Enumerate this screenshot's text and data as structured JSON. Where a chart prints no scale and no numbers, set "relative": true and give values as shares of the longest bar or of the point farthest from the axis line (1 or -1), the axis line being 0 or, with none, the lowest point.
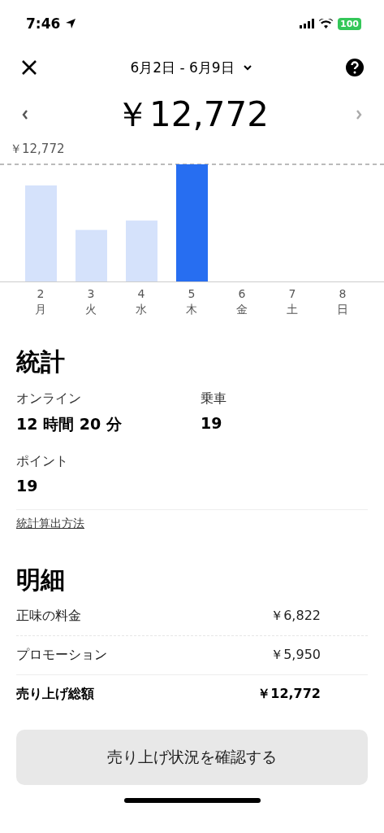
{
  "status_bar": {
    "time": "7:46",
    "battery": "100"
  },
  "header": {
    "date_range": "6月2日 - 6月9日"
  },
  "total": {
    "amount": "￥12,772"
  },
  "chart": {
    "chart_data": {
      "type": "bar",
      "relative": true,
      "categories": [
        "2\n月",
        "3\n火",
        "4\n水",
        "5\n木",
        "6\n金",
        "7\n土",
        "8\n日"
      ],
      "series": [
        {
          "color": "#d5e2fb",
          "values": [
            0.82,
            0.44,
            0.52,
            null,
            null,
            null,
            null
          ]
        },
        {
          "color": "#276ef1",
          "values": [
            null,
            null,
            null,
            1,
            null,
            null,
            null
          ]
        }
      ],
      "annotations": [
        {
          "text": "￥12,772"
        }
      ]
    }
  },
  "stats": {
    "title": "統計",
    "items": [
      {
        "label": "オンライン",
        "value": "12 時間 20 分"
      },
      {
        "label": "乗車",
        "value": "19"
      },
      {
        "label": "ポイント",
        "value": "19"
      }
    ],
    "link": "統計算出方法"
  },
  "breakdown": {
    "title": "明細",
    "rows": [
      {
        "label": "正味の料金",
        "amount": "￥6,822",
        "kind": "item"
      },
      {
        "label": "プロモーション",
        "amount": "￥5,950",
        "kind": "item"
      },
      {
        "label": "売り上げ総額",
        "amount": "￥12,772",
        "kind": "total"
      }
    ]
  },
  "button": "売り上げ状況を確認する"
}
